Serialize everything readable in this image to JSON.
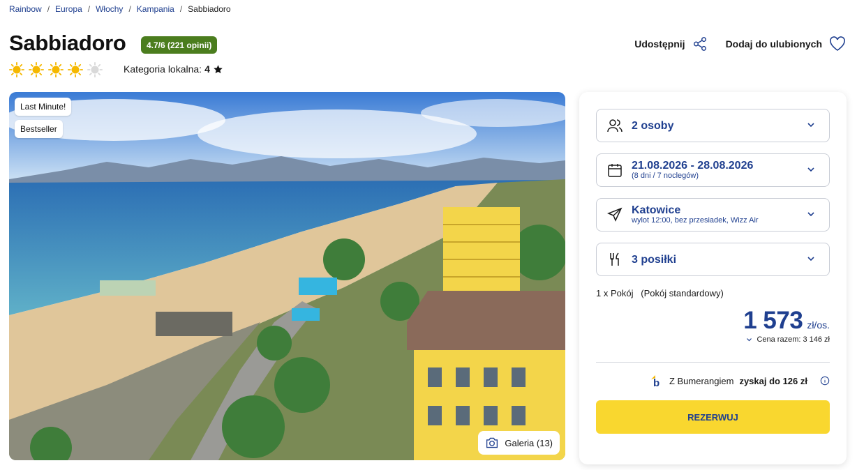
{
  "breadcrumb": [
    "Rainbow",
    "Europa",
    "Włochy",
    "Kampania",
    "Sabbiadoro"
  ],
  "hotel": {
    "name": "Sabbiadoro",
    "rating_badge": "4.7/6 (221 opinii)",
    "sun_rating": 4,
    "sun_max": 5,
    "local_category_label": "Kategoria lokalna:",
    "local_category_value": "4"
  },
  "actions": {
    "share": "Udostępnij",
    "favorite": "Dodaj do ulubionych"
  },
  "hero": {
    "tags": [
      "Last Minute!",
      "Bestseller"
    ],
    "gallery_label": "Galeria (13)"
  },
  "booking": {
    "persons": "2 osoby",
    "dates": "21.08.2026 - 28.08.2026",
    "dates_sub": "(8 dni / 7 noclegów)",
    "departure": "Katowice",
    "departure_sub": "wylot 12:00, bez przesiadek, Wizz Air",
    "meals": "3 posiłki",
    "room": "1 x Pokój   (Pokój standardowy)",
    "price": "1 573",
    "price_unit": "zł/os.",
    "total": "Cena razem: 3 146 zł",
    "boomerang_prefix": "Z Bumerangiem",
    "boomerang_strong": "zyskaj do 126 zł",
    "reserve_label": "REZERWUJ"
  },
  "colors": {
    "brand_blue": "#1f3f8f",
    "rating_green": "#4b7d1e",
    "reserve_yellow": "#f9d72f",
    "sun": "#f5b800"
  }
}
